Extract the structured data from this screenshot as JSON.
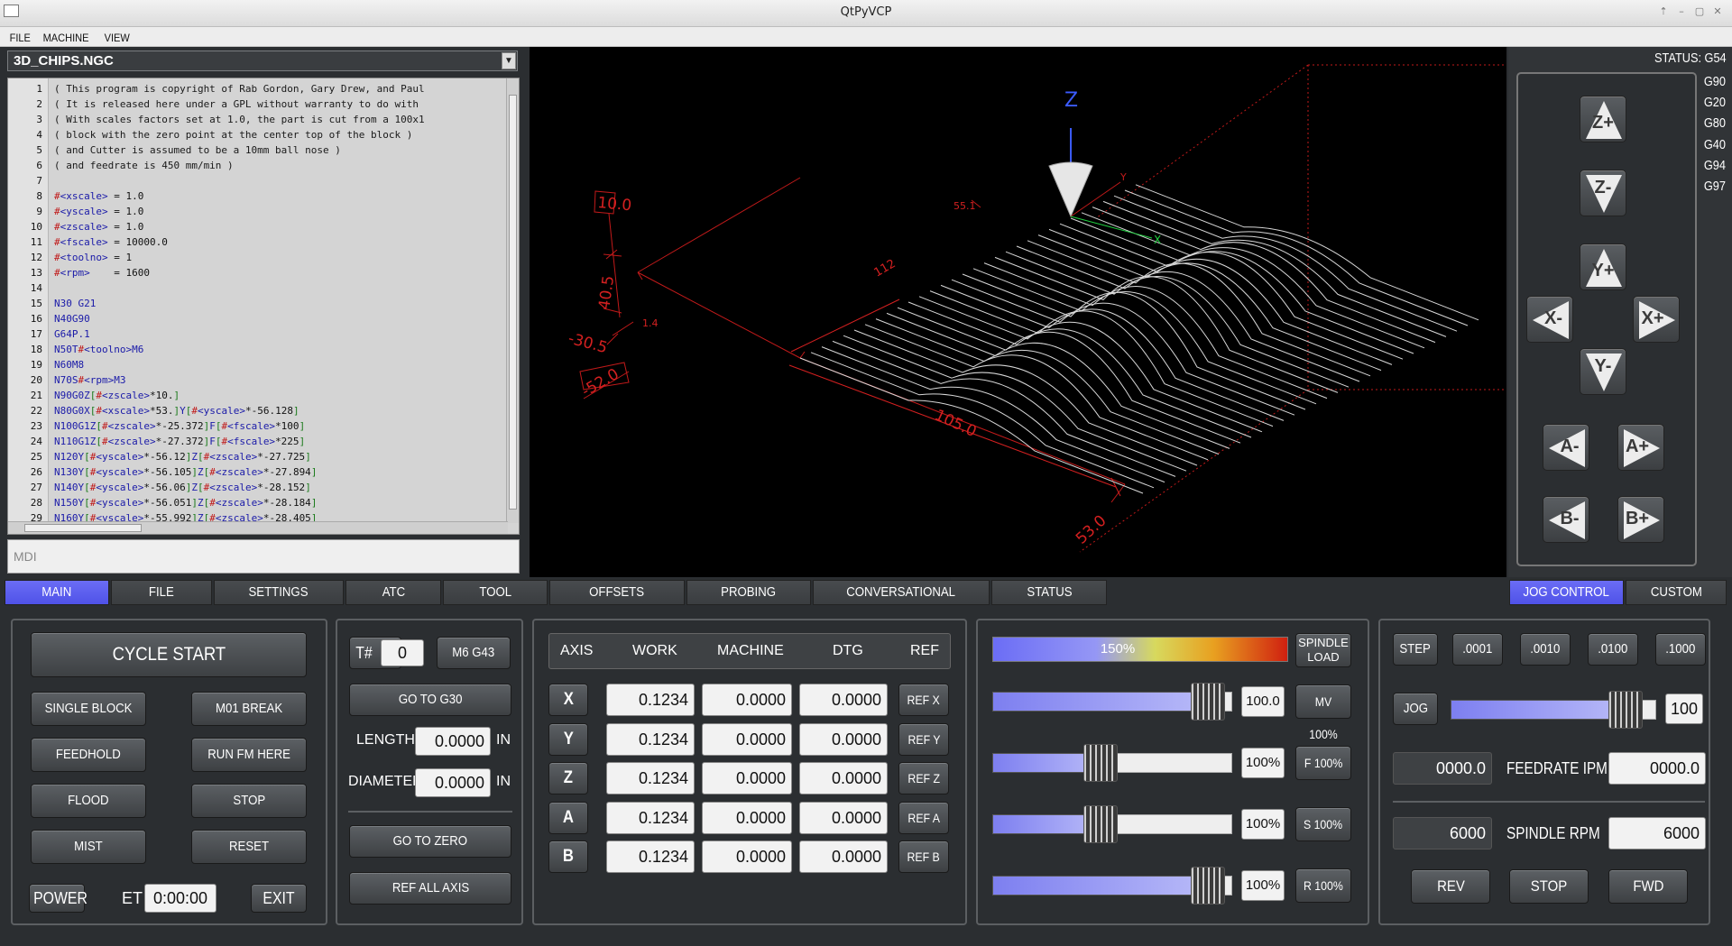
{
  "window": {
    "title": "QtPyVCP"
  },
  "menu": [
    "FILE",
    "MACHINE",
    "VIEW"
  ],
  "file_selector": {
    "value": "3D_CHIPS.NGC"
  },
  "editor": {
    "lines": [
      {
        "n": "1",
        "parts": [
          [
            "c-cmt",
            "( This program is copyright of Rab Gordon, Gary Drew, and Paul"
          ]
        ]
      },
      {
        "n": "2",
        "parts": [
          [
            "c-cmt",
            "( It is released here under a GPL without warranty to do with"
          ]
        ]
      },
      {
        "n": "3",
        "parts": [
          [
            "c-cmt",
            "( With scales factors set at 1.0, the part is cut from a 100x1"
          ]
        ]
      },
      {
        "n": "4",
        "parts": [
          [
            "c-cmt",
            "( block with the zero point at the center top of the block )"
          ]
        ]
      },
      {
        "n": "5",
        "parts": [
          [
            "c-cmt",
            "( and Cutter is assumed to be a 10mm ball nose )"
          ]
        ]
      },
      {
        "n": "6",
        "parts": [
          [
            "c-cmt",
            "( and feedrate is 450 mm/min )"
          ]
        ]
      },
      {
        "n": "7",
        "parts": []
      },
      {
        "n": "8",
        "parts": [
          [
            "c-var",
            "#"
          ],
          [
            "c-kw",
            "<xscale>"
          ],
          [
            "c-num",
            " = 1.0"
          ]
        ]
      },
      {
        "n": "9",
        "parts": [
          [
            "c-var",
            "#"
          ],
          [
            "c-kw",
            "<yscale>"
          ],
          [
            "c-num",
            " = 1.0"
          ]
        ]
      },
      {
        "n": "10",
        "parts": [
          [
            "c-var",
            "#"
          ],
          [
            "c-kw",
            "<zscale>"
          ],
          [
            "c-num",
            " = 1.0"
          ]
        ]
      },
      {
        "n": "11",
        "parts": [
          [
            "c-var",
            "#"
          ],
          [
            "c-kw",
            "<fscale>"
          ],
          [
            "c-num",
            " = 10000.0"
          ]
        ]
      },
      {
        "n": "12",
        "parts": [
          [
            "c-var",
            "#"
          ],
          [
            "c-kw",
            "<toolno>"
          ],
          [
            "c-num",
            " = 1"
          ]
        ]
      },
      {
        "n": "13",
        "parts": [
          [
            "c-var",
            "#"
          ],
          [
            "c-kw",
            "<rpm>"
          ],
          [
            "c-num",
            "    = 1600"
          ]
        ]
      },
      {
        "n": "14",
        "parts": []
      },
      {
        "n": "15",
        "parts": [
          [
            "c-kw",
            "N30 G21"
          ]
        ]
      },
      {
        "n": "16",
        "parts": [
          [
            "c-kw",
            "N40G90"
          ]
        ]
      },
      {
        "n": "17",
        "parts": [
          [
            "c-kw",
            "G64P.1"
          ]
        ]
      },
      {
        "n": "18",
        "parts": [
          [
            "c-kw",
            "N50T"
          ],
          [
            "c-var",
            "#"
          ],
          [
            "c-kw",
            "<toolno>"
          ],
          [
            "c-kw",
            "M6"
          ]
        ]
      },
      {
        "n": "19",
        "parts": [
          [
            "c-kw",
            "N60M8"
          ]
        ]
      },
      {
        "n": "20",
        "parts": [
          [
            "c-kw",
            "N70S"
          ],
          [
            "c-var",
            "#"
          ],
          [
            "c-kw",
            "<rpm>"
          ],
          [
            "c-kw",
            "M3"
          ]
        ]
      },
      {
        "n": "21",
        "parts": [
          [
            "c-kw",
            "N90G0Z"
          ],
          [
            "c-grn",
            "["
          ],
          [
            "c-var",
            "#"
          ],
          [
            "c-kw",
            "<zscale>"
          ],
          [
            "c-num",
            "*10."
          ],
          [
            "c-grn",
            "]"
          ]
        ]
      },
      {
        "n": "22",
        "parts": [
          [
            "c-kw",
            "N80G0X"
          ],
          [
            "c-grn",
            "["
          ],
          [
            "c-var",
            "#"
          ],
          [
            "c-kw",
            "<xscale>"
          ],
          [
            "c-num",
            "*53."
          ],
          [
            "c-grn",
            "]"
          ],
          [
            "c-kw",
            "Y"
          ],
          [
            "c-grn",
            "["
          ],
          [
            "c-var",
            "#"
          ],
          [
            "c-kw",
            "<yscale>"
          ],
          [
            "c-num",
            "*-56.128"
          ],
          [
            "c-grn",
            "]"
          ]
        ]
      },
      {
        "n": "23",
        "parts": [
          [
            "c-kw",
            "N100G1Z"
          ],
          [
            "c-grn",
            "["
          ],
          [
            "c-var",
            "#"
          ],
          [
            "c-kw",
            "<zscale>"
          ],
          [
            "c-num",
            "*-25.372"
          ],
          [
            "c-grn",
            "]"
          ],
          [
            "c-kw",
            "F"
          ],
          [
            "c-grn",
            "["
          ],
          [
            "c-var",
            "#"
          ],
          [
            "c-kw",
            "<fscale>"
          ],
          [
            "c-num",
            "*100"
          ],
          [
            "c-grn",
            "]"
          ]
        ]
      },
      {
        "n": "24",
        "parts": [
          [
            "c-kw",
            "N110G1Z"
          ],
          [
            "c-grn",
            "["
          ],
          [
            "c-var",
            "#"
          ],
          [
            "c-kw",
            "<zscale>"
          ],
          [
            "c-num",
            "*-27.372"
          ],
          [
            "c-grn",
            "]"
          ],
          [
            "c-kw",
            "F"
          ],
          [
            "c-grn",
            "["
          ],
          [
            "c-var",
            "#"
          ],
          [
            "c-kw",
            "<fscale>"
          ],
          [
            "c-num",
            "*225"
          ],
          [
            "c-grn",
            "]"
          ]
        ]
      },
      {
        "n": "25",
        "parts": [
          [
            "c-kw",
            "N120Y"
          ],
          [
            "c-grn",
            "["
          ],
          [
            "c-var",
            "#"
          ],
          [
            "c-kw",
            "<yscale>"
          ],
          [
            "c-num",
            "*-56.12"
          ],
          [
            "c-grn",
            "]"
          ],
          [
            "c-kw",
            "Z"
          ],
          [
            "c-grn",
            "["
          ],
          [
            "c-var",
            "#"
          ],
          [
            "c-kw",
            "<zscale>"
          ],
          [
            "c-num",
            "*-27.725"
          ],
          [
            "c-grn",
            "]"
          ]
        ]
      },
      {
        "n": "26",
        "parts": [
          [
            "c-kw",
            "N130Y"
          ],
          [
            "c-grn",
            "["
          ],
          [
            "c-var",
            "#"
          ],
          [
            "c-kw",
            "<yscale>"
          ],
          [
            "c-num",
            "*-56.105"
          ],
          [
            "c-grn",
            "]"
          ],
          [
            "c-kw",
            "Z"
          ],
          [
            "c-grn",
            "["
          ],
          [
            "c-var",
            "#"
          ],
          [
            "c-kw",
            "<zscale>"
          ],
          [
            "c-num",
            "*-27.894"
          ],
          [
            "c-grn",
            "]"
          ]
        ]
      },
      {
        "n": "27",
        "parts": [
          [
            "c-kw",
            "N140Y"
          ],
          [
            "c-grn",
            "["
          ],
          [
            "c-var",
            "#"
          ],
          [
            "c-kw",
            "<yscale>"
          ],
          [
            "c-num",
            "*-56.06"
          ],
          [
            "c-grn",
            "]"
          ],
          [
            "c-kw",
            "Z"
          ],
          [
            "c-grn",
            "["
          ],
          [
            "c-var",
            "#"
          ],
          [
            "c-kw",
            "<zscale>"
          ],
          [
            "c-num",
            "*-28.152"
          ],
          [
            "c-grn",
            "]"
          ]
        ]
      },
      {
        "n": "28",
        "parts": [
          [
            "c-kw",
            "N150Y"
          ],
          [
            "c-grn",
            "["
          ],
          [
            "c-var",
            "#"
          ],
          [
            "c-kw",
            "<yscale>"
          ],
          [
            "c-num",
            "*-56.051"
          ],
          [
            "c-grn",
            "]"
          ],
          [
            "c-kw",
            "Z"
          ],
          [
            "c-grn",
            "["
          ],
          [
            "c-var",
            "#"
          ],
          [
            "c-kw",
            "<zscale>"
          ],
          [
            "c-num",
            "*-28.184"
          ],
          [
            "c-grn",
            "]"
          ]
        ]
      },
      {
        "n": "29",
        "parts": [
          [
            "c-kw",
            "N160Y"
          ],
          [
            "c-grn",
            "["
          ],
          [
            "c-var",
            "#"
          ],
          [
            "c-kw",
            "<yscale>"
          ],
          [
            "c-num",
            "*-55.992"
          ],
          [
            "c-grn",
            "]"
          ],
          [
            "c-kw",
            "Z"
          ],
          [
            "c-grn",
            "["
          ],
          [
            "c-var",
            "#"
          ],
          [
            "c-kw",
            "<zscale>"
          ],
          [
            "c-num",
            "*-28.405"
          ],
          [
            "c-grn",
            "]"
          ]
        ]
      }
    ]
  },
  "mdi": {
    "placeholder": "MDI"
  },
  "viewport": {
    "dims": [
      "10.0",
      "40.5",
      "-30.5",
      "-52.0",
      "105.0",
      "53.0",
      "112",
      "55.1",
      "1.4"
    ],
    "axis_labels": [
      "Z",
      "Y",
      "X"
    ],
    "colors": {
      "dims": "#d42020",
      "path": "#d8d8d8",
      "axis_z": "#3b5bff",
      "axis_x": "#20d040"
    }
  },
  "status": {
    "label": "STATUS: G54",
    "gcodes": [
      "G90",
      "G20",
      "G80",
      "G40",
      "G94",
      "G97"
    ]
  },
  "jog": {
    "z_plus": "Z+",
    "z_minus": "Z-",
    "y_plus": "Y+",
    "y_minus": "Y-",
    "x_minus": "X-",
    "x_plus": "X+",
    "a_minus": "A-",
    "a_plus": "A+",
    "b_minus": "B-",
    "b_plus": "B+"
  },
  "tabs": [
    {
      "label": "MAIN",
      "active": true
    },
    {
      "label": "FILE"
    },
    {
      "label": "SETTINGS"
    },
    {
      "label": "ATC"
    },
    {
      "label": "TOOL"
    },
    {
      "label": "OFFSETS"
    },
    {
      "label": "PROBING"
    },
    {
      "label": "CONVERSATIONAL"
    },
    {
      "label": "STATUS"
    }
  ],
  "right_tabs": [
    {
      "label": "JOG CONTROL",
      "active": true
    },
    {
      "label": "CUSTOM"
    }
  ],
  "main_panel": {
    "cycle_start": "CYCLE START",
    "single_block": "SINGLE BLOCK",
    "m01_break": "M01 BREAK",
    "feedhold": "FEEDHOLD",
    "run_fm_here": "RUN FM HERE",
    "flood": "FLOOD",
    "stop": "STOP",
    "mist": "MIST",
    "reset": "RESET",
    "power": "POWER",
    "et_label": "ET",
    "et_value": "0:00:00",
    "exit": "EXIT"
  },
  "tool_panel": {
    "t_label": "T#",
    "t_value": "0",
    "m6g43": "M6 G43",
    "go_g30": "GO TO G30",
    "length_label": "LENGTH",
    "length_value": "0.0000",
    "length_unit": "IN",
    "diameter_label": "DIAMETER",
    "diameter_value": "0.0000",
    "diameter_unit": "IN",
    "go_zero": "GO TO ZERO",
    "ref_all": "REF ALL AXIS"
  },
  "dro": {
    "headers": [
      "AXIS",
      "WORK",
      "MACHINE",
      "DTG",
      "REF"
    ],
    "rows": [
      {
        "axis": "X",
        "work": "0.1234",
        "machine": "0.0000",
        "dtg": "0.0000",
        "ref": "REF X"
      },
      {
        "axis": "Y",
        "work": "0.1234",
        "machine": "0.0000",
        "dtg": "0.0000",
        "ref": "REF Y"
      },
      {
        "axis": "Z",
        "work": "0.1234",
        "machine": "0.0000",
        "dtg": "0.0000",
        "ref": "REF Z"
      },
      {
        "axis": "A",
        "work": "0.1234",
        "machine": "0.0000",
        "dtg": "0.0000",
        "ref": "REF A"
      },
      {
        "axis": "B",
        "work": "0.1234",
        "machine": "0.0000",
        "dtg": "0.0000",
        "ref": "REF B"
      }
    ]
  },
  "overrides": {
    "spindle_load": {
      "value_label": "150%",
      "fraction": 0.7,
      "label1": "SPINDLE",
      "label2": "LOAD"
    },
    "sliders": [
      {
        "name": "mv",
        "value": "100.0",
        "fraction": 0.9,
        "button": "MV 100%"
      },
      {
        "name": "f",
        "value": "100%",
        "fraction": 0.45,
        "button": "F 100%"
      },
      {
        "name": "s",
        "value": "100%",
        "fraction": 0.45,
        "button": "S 100%"
      },
      {
        "name": "r",
        "value": "100%",
        "fraction": 0.9,
        "button": "R 100%"
      }
    ]
  },
  "jog_panel": {
    "step": "STEP",
    "steps": [
      ".0001",
      ".0010",
      ".0100",
      ".1000"
    ],
    "jog": "JOG",
    "jog_value": "100",
    "jog_fraction": 0.85,
    "feed_actual": "0000.0",
    "feed_label": "FEEDRATE IPM",
    "feed_set": "0000.0",
    "spindle_actual": "6000",
    "spindle_label": "SPINDLE RPM",
    "spindle_set": "6000",
    "rev": "REV",
    "stop": "STOP",
    "fwd": "FWD"
  }
}
